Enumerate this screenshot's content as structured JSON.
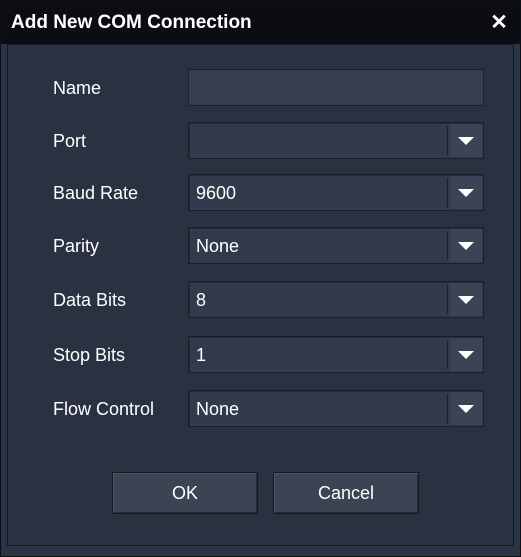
{
  "window": {
    "title": "Add New COM Connection",
    "close_icon": "close-icon",
    "colors": {
      "titlebar": "#0b0d12",
      "background": "#2a3241",
      "field": "#323b4b",
      "text": "#ffffff"
    }
  },
  "form": {
    "name": {
      "label": "Name",
      "value": ""
    },
    "port": {
      "label": "Port",
      "value": ""
    },
    "baud_rate": {
      "label": "Baud Rate",
      "value": "9600"
    },
    "parity": {
      "label": "Parity",
      "value": "None"
    },
    "data_bits": {
      "label": "Data Bits",
      "value": "8"
    },
    "stop_bits": {
      "label": "Stop Bits",
      "value": "1"
    },
    "flow_control": {
      "label": "Flow Control",
      "value": "None"
    }
  },
  "buttons": {
    "ok": "OK",
    "cancel": "Cancel"
  }
}
